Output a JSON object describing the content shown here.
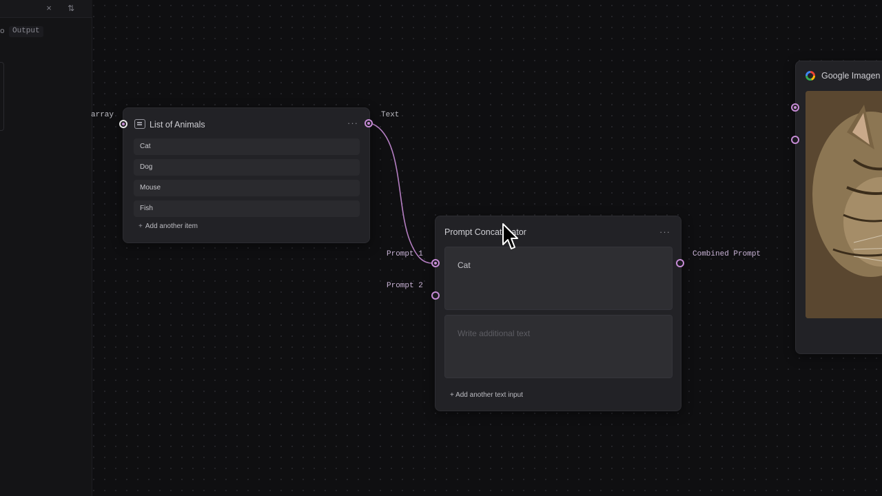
{
  "side_panel": {
    "close_label": "×",
    "sort_label": "⇅",
    "tab_prefix": "o",
    "output_tab": "Output"
  },
  "port_labels": {
    "array": "array",
    "text": "Text",
    "prompt1": "Prompt 1",
    "prompt2": "Prompt 2",
    "combined": "Combined Prompt"
  },
  "list_node": {
    "title": "List of Animals",
    "icon": "list-icon",
    "menu": "···",
    "items": [
      "Cat",
      "Dog",
      "Mouse",
      "Fish"
    ],
    "add_label": "Add another item"
  },
  "concat_node": {
    "title": "Prompt Concatenator",
    "menu": "···",
    "input1_value": "Cat",
    "input2_placeholder": "Write additional text",
    "add_label": "+ Add another text input"
  },
  "imagen_node": {
    "title": "Google Imagen",
    "icon": "google-icon"
  },
  "colors": {
    "port_accent": "#c68bd6",
    "wire": "#c68bd6",
    "canvas": "#0f0f11",
    "node": "#222226"
  }
}
